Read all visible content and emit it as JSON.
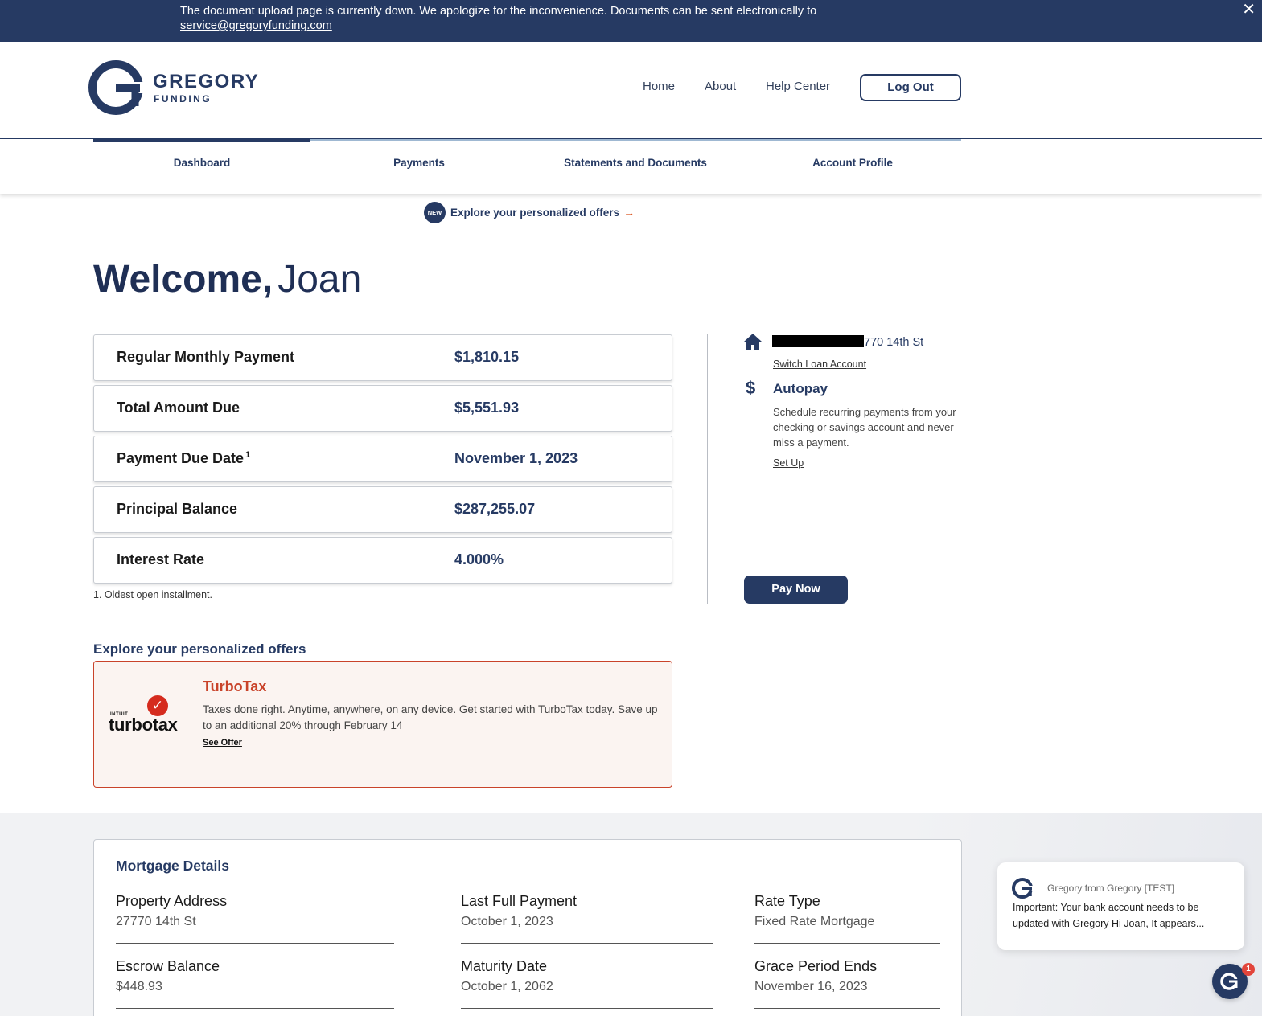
{
  "alert": {
    "message": "The document upload page is currently down. We apologize for the inconvenience. Documents can be sent electronically to",
    "email": "service@gregoryfunding.com",
    "close_glyph": "✕"
  },
  "header": {
    "logo_word1": "GREGORY",
    "logo_word2": "FUNDING",
    "nav": [
      "Home",
      "About",
      "Help Center"
    ],
    "logout_label": "Log Out"
  },
  "tabs": [
    "Dashboard",
    "Payments",
    "Statements and Documents",
    "Account Profile"
  ],
  "offers_banner": {
    "badge": "NEW",
    "label": "Explore your personalized offers",
    "arrow": "→"
  },
  "welcome": {
    "greeting": "Welcome,",
    "name": "Joan"
  },
  "stats": [
    {
      "label": "Regular Monthly Payment",
      "sup": "",
      "value": "$1,810.15"
    },
    {
      "label": "Total Amount Due",
      "sup": "",
      "value": "$5,551.93"
    },
    {
      "label": "Payment Due Date",
      "sup": "1",
      "value": "November 1, 2023"
    },
    {
      "label": "Principal Balance",
      "sup": "",
      "value": "$287,255.07"
    },
    {
      "label": "Interest Rate",
      "sup": "",
      "value": "4.000%"
    }
  ],
  "footnote": "1. Oldest open installment.",
  "sidebar": {
    "address_tail": "770 14th St",
    "switch_label": "Switch Loan Account",
    "dollar_glyph": "$",
    "autopay_title": "Autopay",
    "autopay_desc": "Schedule recurring payments from your checking or savings account and never miss a payment.",
    "setup_label": "Set Up",
    "paynow_label": "Pay Now"
  },
  "offers": {
    "heading": "Explore your personalized offers",
    "logo_check": "✓",
    "logo_intuit": "INTUIT",
    "logo_word": "turbotax",
    "title": "TurboTax",
    "description": "Taxes done right. Anytime, anywhere, on any device. Get started with TurboTax today. Save up to an additional 20% through February 14",
    "link_label": "See Offer"
  },
  "mortgage": {
    "title": "Mortgage Details",
    "fields": [
      {
        "label": "Property Address",
        "value": "27770 14th St"
      },
      {
        "label": "Last Full Payment",
        "value": "October 1, 2023"
      },
      {
        "label": "Rate Type",
        "value": "Fixed Rate Mortgage"
      },
      {
        "label": "Escrow Balance",
        "value": "$448.93"
      },
      {
        "label": "Maturity Date",
        "value": "October 1, 2062"
      },
      {
        "label": "Grace Period Ends",
        "value": "November 16, 2023"
      }
    ]
  },
  "chat": {
    "from": "Gregory from Gregory [TEST]",
    "message": "Important: Your bank account needs to be updated with Gregory Hi Joan, It appears...",
    "badge_count": "1"
  },
  "colors": {
    "navy": "#263a63",
    "accent_orange": "#d9531e",
    "offer_red": "#c9432a"
  }
}
